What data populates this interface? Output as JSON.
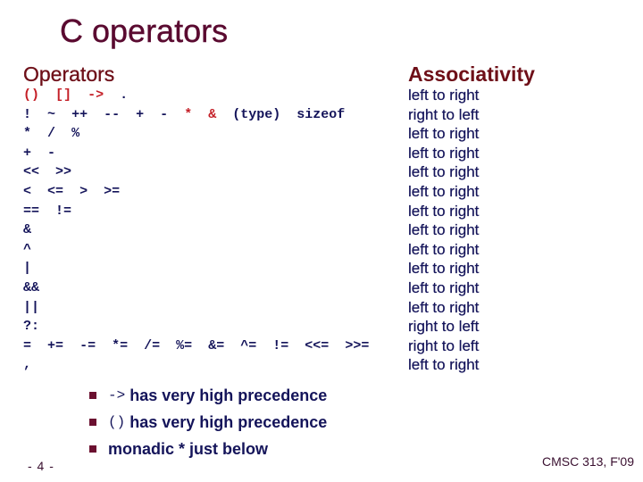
{
  "slide": {
    "title": "C operators",
    "operators_heading": "Operators",
    "associativity_heading": "Associativity",
    "rows": [
      {
        "operators": [
          {
            "text": "()",
            "highlight": true
          },
          {
            "text": "[]",
            "highlight": true
          },
          {
            "text": "->",
            "highlight": true
          },
          {
            "text": ".",
            "highlight": false
          }
        ],
        "associativity": "left to right"
      },
      {
        "operators": [
          {
            "text": "!",
            "highlight": false
          },
          {
            "text": "~",
            "highlight": false
          },
          {
            "text": "++",
            "highlight": false
          },
          {
            "text": "--",
            "highlight": false
          },
          {
            "text": "+",
            "highlight": false
          },
          {
            "text": "-",
            "highlight": false
          },
          {
            "text": "*",
            "highlight": true
          },
          {
            "text": "&",
            "highlight": true
          },
          {
            "text": "(type)",
            "highlight": false
          },
          {
            "text": "sizeof",
            "highlight": false
          }
        ],
        "associativity": "right to left"
      },
      {
        "operators": [
          {
            "text": "*",
            "highlight": false
          },
          {
            "text": "/",
            "highlight": false
          },
          {
            "text": "%",
            "highlight": false
          }
        ],
        "associativity": "left to right"
      },
      {
        "operators": [
          {
            "text": "+",
            "highlight": false
          },
          {
            "text": "-",
            "highlight": false
          }
        ],
        "associativity": "left to right"
      },
      {
        "operators": [
          {
            "text": "<<",
            "highlight": false
          },
          {
            "text": ">>",
            "highlight": false
          }
        ],
        "associativity": "left to right"
      },
      {
        "operators": [
          {
            "text": "<",
            "highlight": false
          },
          {
            "text": "<=",
            "highlight": false
          },
          {
            "text": ">",
            "highlight": false
          },
          {
            "text": ">=",
            "highlight": false
          }
        ],
        "associativity": "left to right"
      },
      {
        "operators": [
          {
            "text": "==",
            "highlight": false
          },
          {
            "text": "!=",
            "highlight": false
          }
        ],
        "associativity": "left to right"
      },
      {
        "operators": [
          {
            "text": "&",
            "highlight": false
          }
        ],
        "associativity": "left to right"
      },
      {
        "operators": [
          {
            "text": "^",
            "highlight": false
          }
        ],
        "associativity": "left to right"
      },
      {
        "operators": [
          {
            "text": "|",
            "highlight": false
          }
        ],
        "associativity": "left to right"
      },
      {
        "operators": [
          {
            "text": "&&",
            "highlight": false
          }
        ],
        "associativity": "left to right"
      },
      {
        "operators": [
          {
            "text": "||",
            "highlight": false
          }
        ],
        "associativity": "left to right"
      },
      {
        "operators": [
          {
            "text": "?:",
            "highlight": false
          }
        ],
        "associativity": "right to left"
      },
      {
        "operators": [
          {
            "text": "=",
            "highlight": false
          },
          {
            "text": "+=",
            "highlight": false
          },
          {
            "text": "-=",
            "highlight": false
          },
          {
            "text": "*=",
            "highlight": false
          },
          {
            "text": "/=",
            "highlight": false
          },
          {
            "text": "%=",
            "highlight": false
          },
          {
            "text": "&=",
            "highlight": false
          },
          {
            "text": "^=",
            "highlight": false
          },
          {
            "text": "!=",
            "highlight": false
          },
          {
            "text": "<<=",
            "highlight": false
          },
          {
            "text": ">>=",
            "highlight": false
          }
        ],
        "associativity": "right to left"
      },
      {
        "operators": [
          {
            "text": ",",
            "highlight": false
          }
        ],
        "associativity": "left to right"
      }
    ],
    "notes": [
      {
        "code": "->",
        "text": " has very high precedence"
      },
      {
        "code": "()",
        "text": " has very high precedence"
      },
      {
        "code": "",
        "text": "monadic * just below"
      }
    ],
    "page_number": "- 4 -",
    "footer": "CMSC 313, F'09",
    "colors": {
      "title": "#5a0a30",
      "heading": "#6e0f18",
      "text": "#14145a",
      "highlight": "#c41e26",
      "bullet": "#6b1030"
    }
  }
}
